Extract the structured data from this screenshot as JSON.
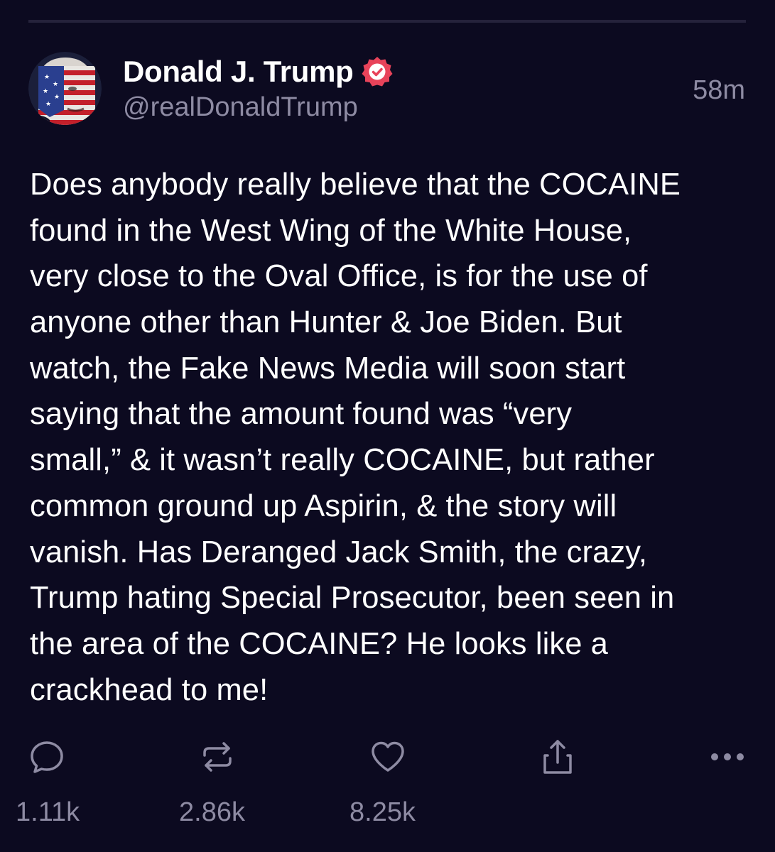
{
  "colors": {
    "background": "#0c0a20",
    "divider": "#25223b",
    "text_primary": "#ffffff",
    "text_secondary": "#8e8ba3",
    "verified_badge": "#e8435a"
  },
  "post": {
    "author": {
      "display_name": "Donald J. Trump",
      "handle": "@realDonaldTrump",
      "verified": true,
      "avatar_icon": "flag-painted-face-avatar"
    },
    "timestamp": "58m",
    "body_lines": [
      "Does anybody really believe that the COCAINE",
      "found in the West Wing of the White House,",
      "very close to the Oval Office, is for the use of",
      "anyone other than Hunter & Joe Biden. But",
      "watch, the Fake News Media will soon start",
      "saying that the amount found was “very",
      "small,” & it wasn’t really COCAINE, but rather",
      "common ground up Aspirin, & the story will",
      "vanish. Has Deranged Jack Smith, the crazy,",
      "Trump hating Special Prosecutor, been seen in",
      "the area of the COCAINE? He looks like a",
      "crackhead to me!"
    ],
    "actions": {
      "reply": {
        "icon": "reply-bubble-icon",
        "count": "1.11k"
      },
      "repost": {
        "icon": "repost-icon",
        "count": "2.86k"
      },
      "like": {
        "icon": "heart-icon",
        "count": "8.25k"
      },
      "share": {
        "icon": "share-icon"
      },
      "more": {
        "icon": "more-dots-icon"
      }
    }
  }
}
